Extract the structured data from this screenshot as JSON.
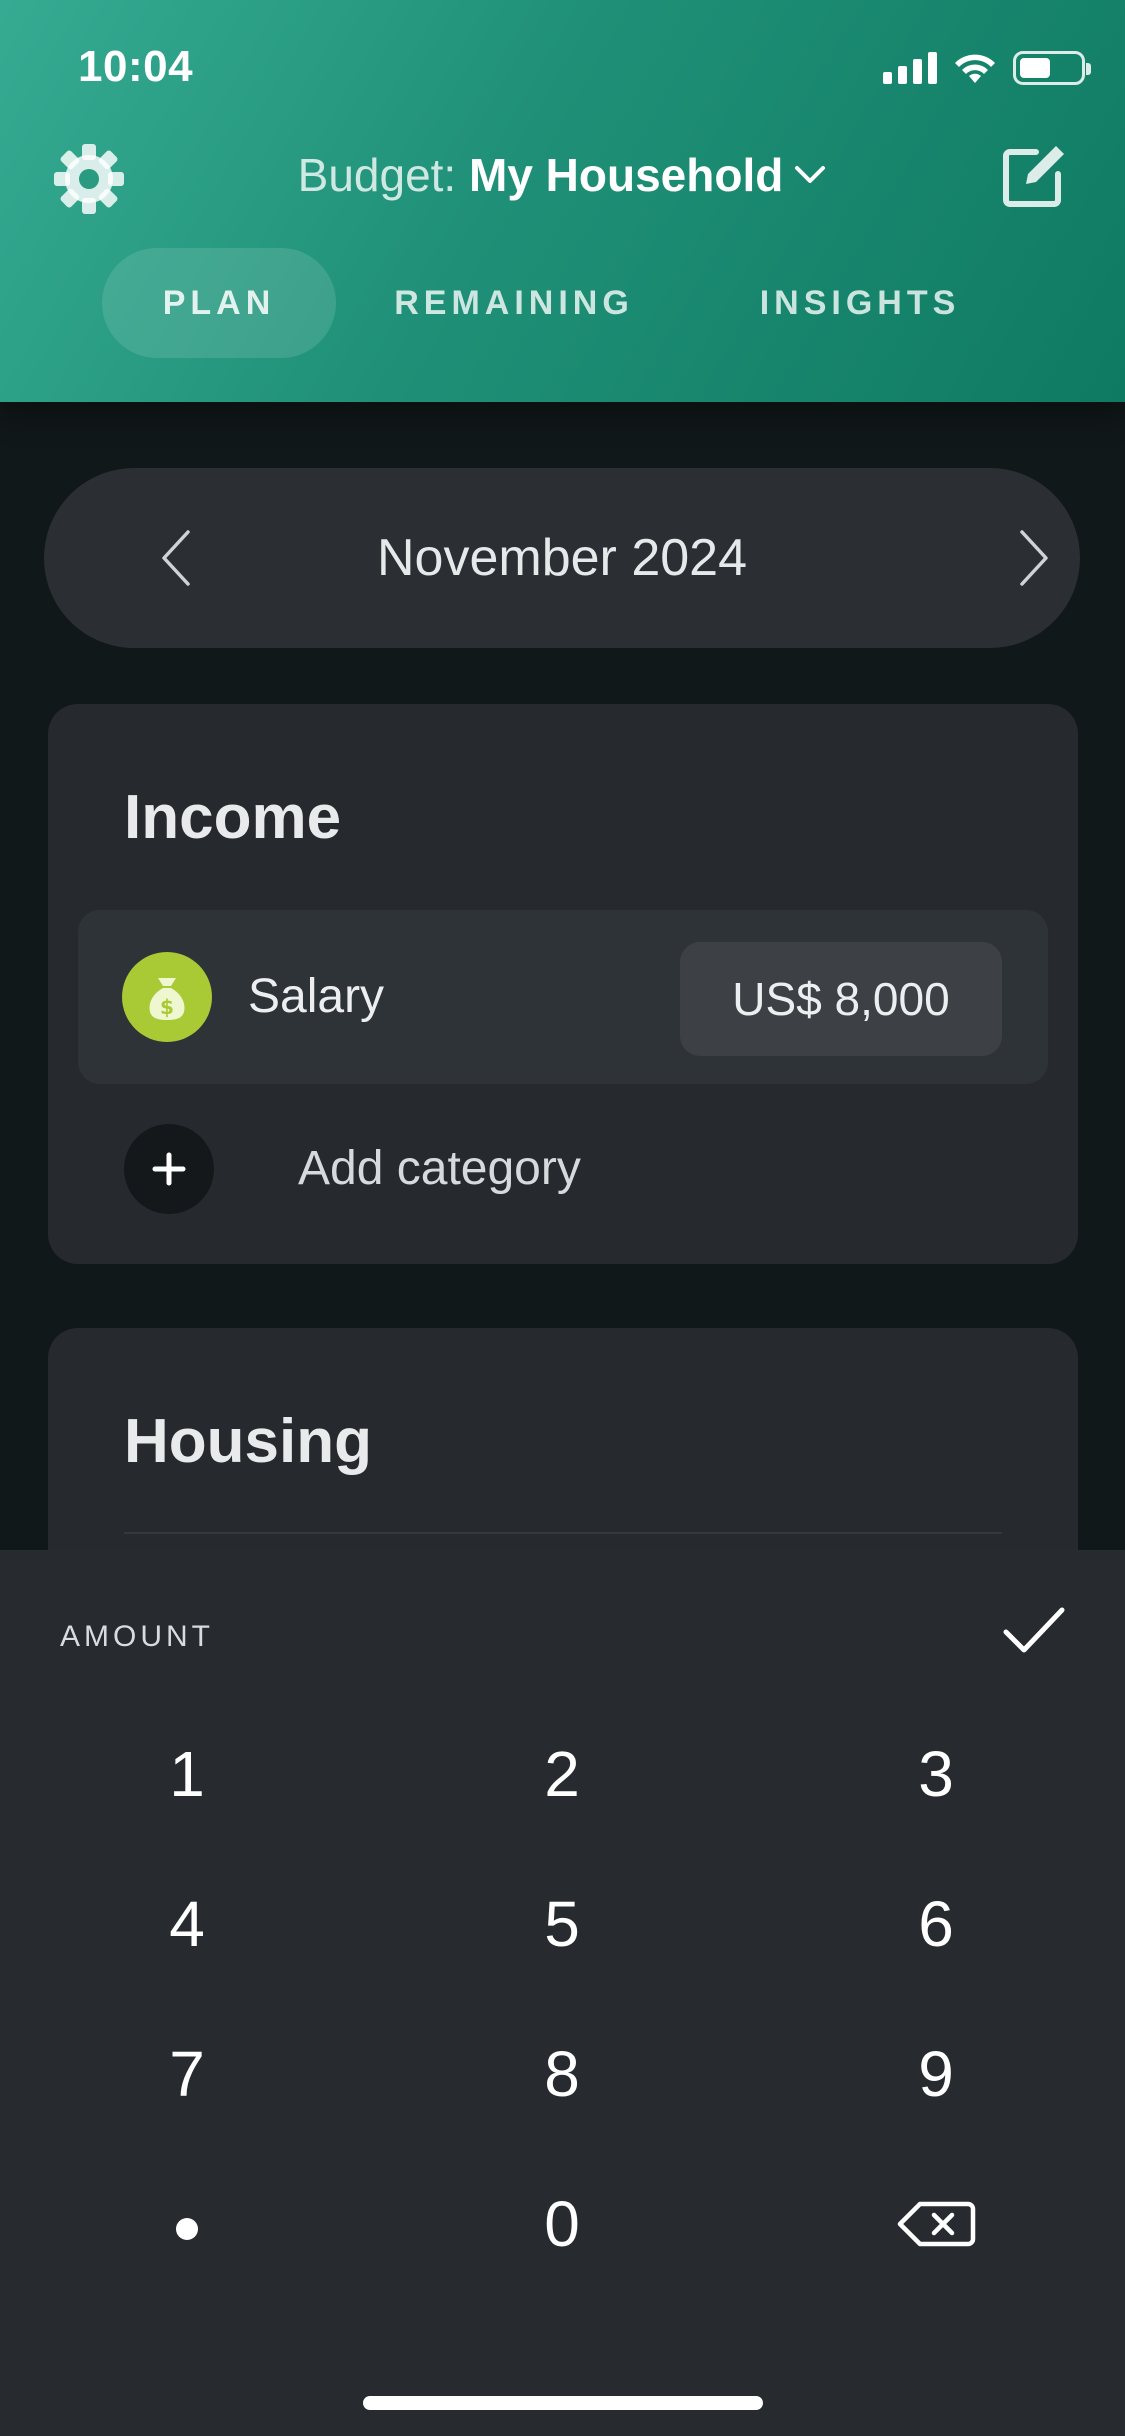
{
  "status_bar": {
    "time": "10:04"
  },
  "header": {
    "budget_prefix": "Budget: ",
    "budget_name": "My Household",
    "tabs": [
      {
        "label": "PLAN",
        "active": true
      },
      {
        "label": "REMAINING",
        "active": false
      },
      {
        "label": "INSIGHTS",
        "active": false
      }
    ]
  },
  "month_selector": {
    "label": "November 2024"
  },
  "income": {
    "title": "Income",
    "items": [
      {
        "label": "Salary",
        "amount": "US$ 8,000",
        "icon": "money-bag-icon"
      }
    ],
    "add_label": "Add category"
  },
  "housing": {
    "title": "Housing"
  },
  "keypad": {
    "label": "AMOUNT",
    "keys": [
      "1",
      "2",
      "3",
      "4",
      "5",
      "6",
      "7",
      "8",
      "9",
      "0"
    ]
  },
  "colors": {
    "header_gradient_start": "#36ab92",
    "header_gradient_end": "#0f7a62",
    "background": "#111819",
    "card": "#262a2e",
    "salary_icon": "#a9c935",
    "keypad": "#272b30"
  }
}
